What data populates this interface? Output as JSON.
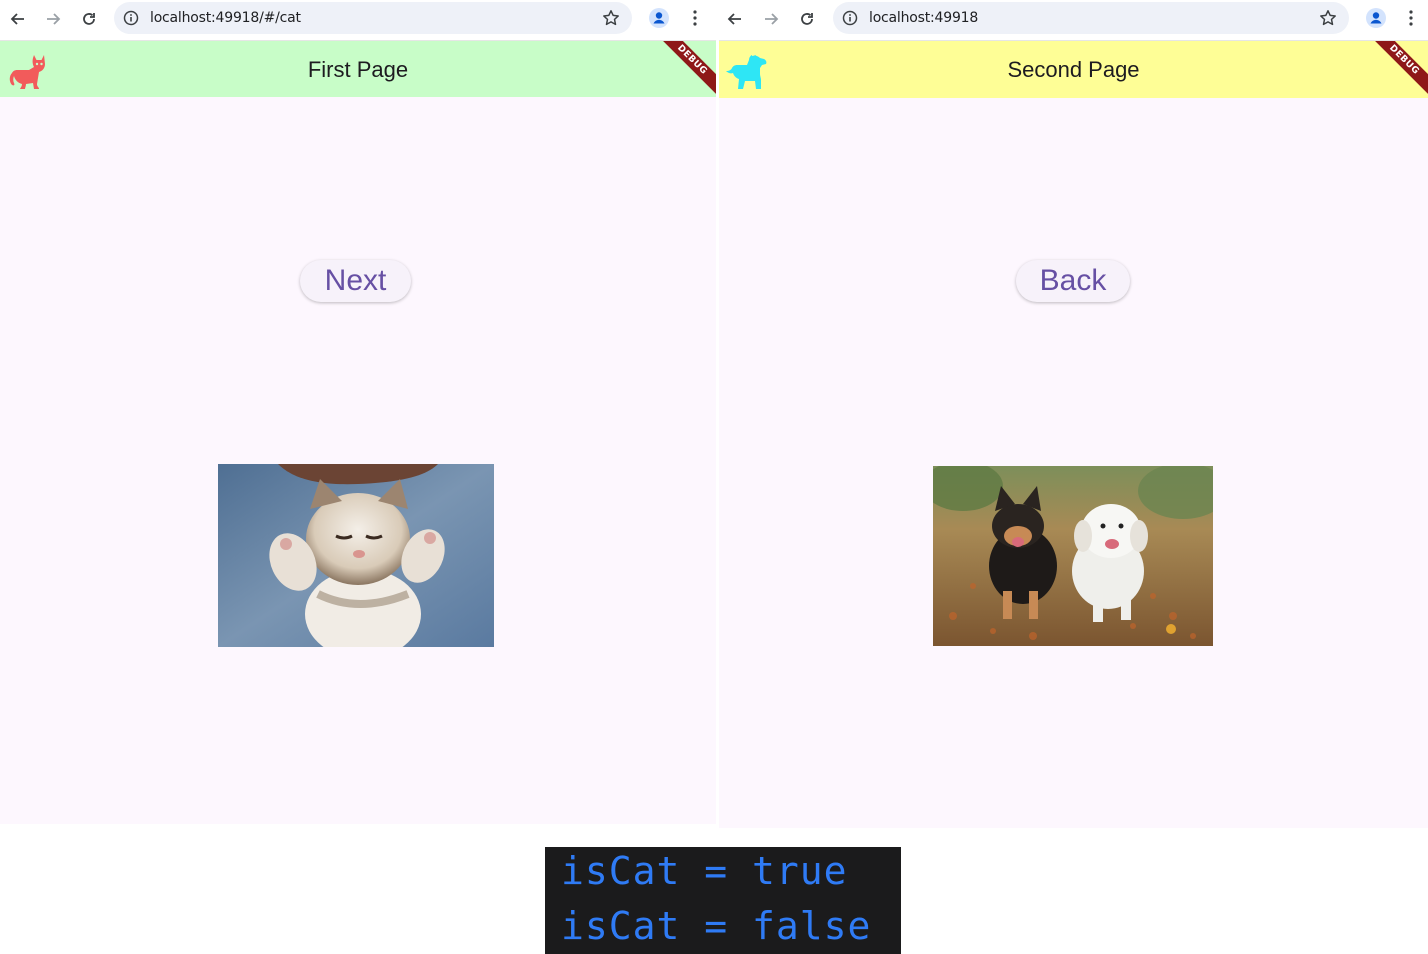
{
  "left_window": {
    "url": "localhost:49918/#/cat",
    "appbar": {
      "title": "First Page",
      "color": "#c8fdc8",
      "icon": "cat-icon",
      "icon_color": "#f25b5b"
    },
    "debug_label": "DEBUG",
    "button_label": "Next",
    "image": "kitten-photo"
  },
  "right_window": {
    "url": "localhost:49918",
    "appbar": {
      "title": "Second Page",
      "color": "#fefe96",
      "icon": "dog-icon",
      "icon_color": "#2ee6f5"
    },
    "debug_label": "DEBUG",
    "button_label": "Back",
    "image": "dogs-photo"
  },
  "console": {
    "lines": [
      "isCat = true",
      "isCat = false"
    ],
    "text_color": "#2f7bf5",
    "background": "#1b1b1c"
  },
  "colors": {
    "page_background": "#fdf7fe",
    "button_text": "#6750a4",
    "debug_ribbon": "#8e1818"
  }
}
